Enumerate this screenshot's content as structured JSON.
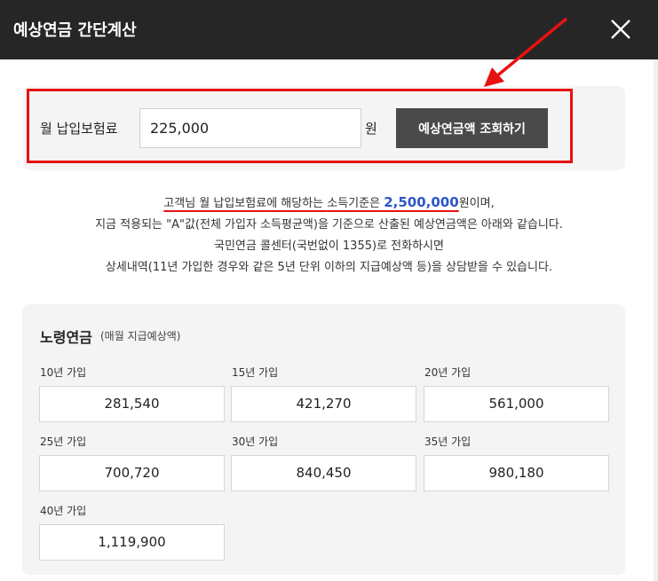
{
  "header": {
    "title": "예상연금 간단계산"
  },
  "form": {
    "label": "월 납입보험료",
    "value": "225,000",
    "unit": "원",
    "button": "예상연금액 조회하기"
  },
  "info": {
    "l1_a": "고객님 월 납입보험료",
    "l1_b": "에 해당하는 ",
    "l1_c": "소득기준은",
    "l1_amount": "2,500,000",
    "l1_d": "원이며,",
    "l2": "지금 적용되는 \"A\"값(전체 가입자 소득평균액)을 기준으로 산출된 예상연금액은 아래와 같습니다.",
    "l3": "국민연금 콜센터(국번없이 1355)로 전화하시면",
    "l4": "상세내역(11년 가입한 경우와 같은 5년 단위 이하의 지급예상액 등)을 상담받을 수 있습니다."
  },
  "pension": {
    "title": "노령연금",
    "subtitle": "(매월 지급예상액)",
    "items": [
      {
        "label": "10년 가입",
        "value": "281,540"
      },
      {
        "label": "15년 가입",
        "value": "421,270"
      },
      {
        "label": "20년 가입",
        "value": "561,000"
      },
      {
        "label": "25년 가입",
        "value": "700,720"
      },
      {
        "label": "30년 가입",
        "value": "840,450"
      },
      {
        "label": "35년 가입",
        "value": "980,180"
      },
      {
        "label": "40년 가입",
        "value": "1,119,900"
      }
    ]
  },
  "colors": {
    "header_bg": "#262626",
    "highlight_red": "#e81111",
    "amount_blue": "#2c57c9"
  }
}
